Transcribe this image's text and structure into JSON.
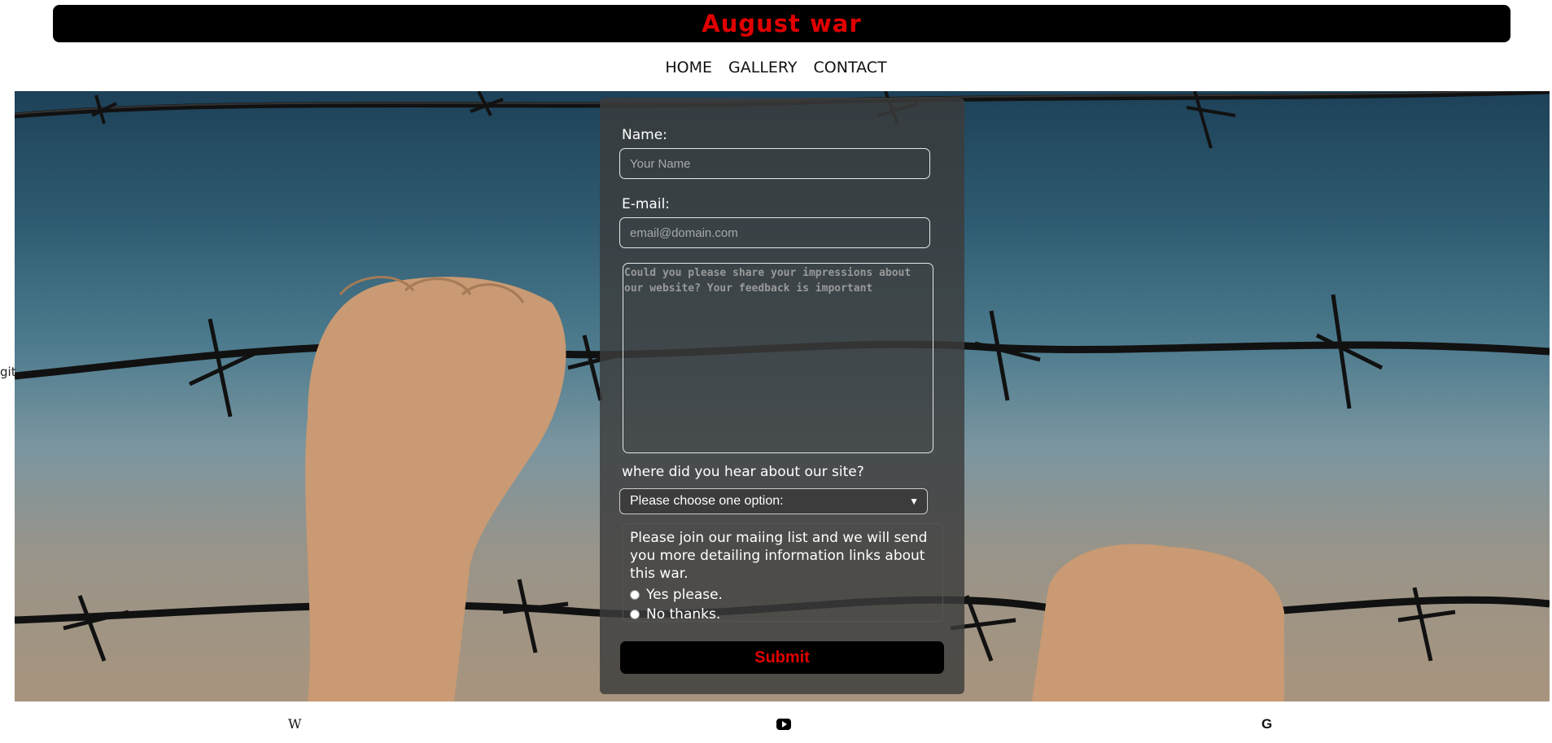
{
  "header": {
    "title": "August war"
  },
  "nav": {
    "home": "HOME",
    "gallery": "GALLERY",
    "contact": "CONTACT"
  },
  "stray": {
    "text": "git"
  },
  "form": {
    "name_label": "Name:",
    "name_placeholder": "Your Name",
    "email_label": "E-mail:",
    "email_placeholder": "email@domain.com",
    "feedback_placeholder": "Could you please share your impressions about our website? Your feedback is important",
    "source_label": "where did you hear about our site?",
    "source_selected": "Please choose one option:",
    "mailing_text": "Please join our maiing list and we will send you more detailing information links about this war.",
    "yes_label": "Yes please.",
    "no_label": "No thanks.",
    "submit_label": "Submit"
  },
  "footer": {
    "wiki_glyph": "W",
    "google_glyph": "G"
  },
  "colors": {
    "accent": "#e00000",
    "header_bg": "#000000"
  },
  "icons": {
    "wiki": "wikipedia-icon",
    "youtube": "youtube-icon",
    "google": "google-icon",
    "select": "chevron-down-icon"
  }
}
